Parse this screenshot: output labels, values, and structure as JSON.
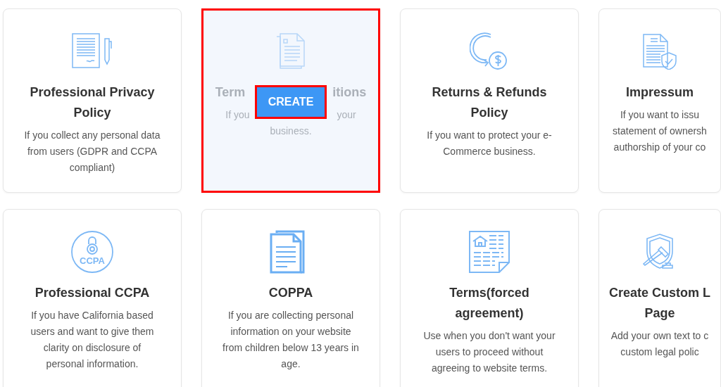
{
  "cards": [
    {
      "hovered": false,
      "title_lines": [
        "Professional Privacy",
        "Policy"
      ],
      "description_lines": [
        "If you collect any personal data",
        "from users (GDPR and CCPA",
        "compliant)"
      ]
    },
    {
      "hovered": true,
      "title_parts": [
        "Term",
        "itions"
      ],
      "description_parts": [
        "If you",
        "your"
      ],
      "description_lines": [
        "business."
      ],
      "button": "CREATE"
    },
    {
      "hovered": false,
      "title_lines": [
        "Returns & Refunds",
        "Policy"
      ],
      "description_lines": [
        "If you want to protect your e-",
        "Commerce business."
      ]
    },
    {
      "hovered": false,
      "title_lines": [
        "Impressum"
      ],
      "description_lines": [
        "If you want to issu",
        "statement of ownersh",
        "authorship of your co"
      ]
    },
    {
      "hovered": false,
      "badge_text": "CCPA",
      "title_lines": [
        "Professional CCPA"
      ],
      "description_lines": [
        "If you have California based",
        "users and want to give them",
        "clarity on disclosure of",
        "personal information."
      ]
    },
    {
      "hovered": false,
      "title_lines": [
        "COPPA"
      ],
      "description_lines": [
        "If you are collecting personal",
        "information on your website",
        "from children below 13 years in",
        "age."
      ]
    },
    {
      "hovered": false,
      "title_lines": [
        "Terms(forced",
        "agreement)"
      ],
      "description_lines": [
        "Use when you don't want your",
        "users to proceed without",
        "agreeing to website terms."
      ]
    },
    {
      "hovered": false,
      "title_lines": [
        "Create Custom L",
        "Page"
      ],
      "description_lines": [
        "Add your own text to c",
        "custom legal polic"
      ]
    }
  ]
}
